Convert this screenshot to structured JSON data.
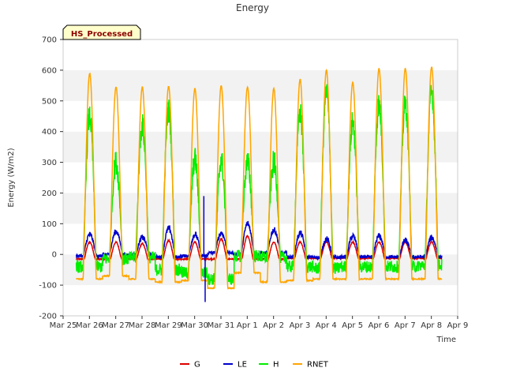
{
  "chart_data": {
    "type": "line",
    "title": "Energy",
    "xlabel": "Time",
    "ylabel": "Energy (W/m2)",
    "ylim": [
      -200,
      700
    ],
    "yticks": [
      -200,
      -100,
      0,
      100,
      200,
      300,
      400,
      500,
      600,
      700
    ],
    "xlim": [
      "Mar 25",
      "Apr 9"
    ],
    "xtick_labels": [
      "Mar 25",
      "Mar 26",
      "Mar 27",
      "Mar 28",
      "Mar 29",
      "Mar 30",
      "Mar 31",
      "Apr 1",
      "Apr 2",
      "Apr 3",
      "Apr 4",
      "Apr 5",
      "Apr 6",
      "Apr 7",
      "Apr 8",
      "Apr 9"
    ],
    "grid": "horizontal bands",
    "legend_position": "bottom",
    "annotation": "HS_Processed",
    "days": [
      "Mar 25",
      "Mar 26",
      "Mar 27",
      "Mar 28",
      "Mar 29",
      "Mar 30",
      "Mar 31",
      "Apr 1",
      "Apr 2",
      "Apr 3",
      "Apr 4",
      "Apr 5",
      "Apr 6",
      "Apr 7",
      "Apr 8"
    ],
    "series": [
      {
        "name": "G",
        "color": "#dd0000",
        "daily_peak": [
          null,
          40,
          40,
          35,
          45,
          40,
          50,
          60,
          40,
          40,
          40,
          40,
          40,
          40,
          40
        ],
        "night_level": [
          null,
          -15,
          -15,
          -15,
          -15,
          -15,
          -15,
          -15,
          -15,
          -12,
          -12,
          -12,
          -12,
          -12,
          -12
        ]
      },
      {
        "name": "LE",
        "color": "#0000cc",
        "daily_peak": [
          null,
          65,
          75,
          55,
          85,
          65,
          70,
          100,
          80,
          70,
          50,
          60,
          60,
          45,
          55
        ],
        "night_level": [
          null,
          -5,
          0,
          0,
          -8,
          -5,
          5,
          0,
          5,
          -8,
          -10,
          -8,
          -8,
          -8,
          -8
        ],
        "extremes": [
          {
            "date": "Mar 30",
            "value": 190
          },
          {
            "date": "Mar 30",
            "value": -155
          }
        ]
      },
      {
        "name": "H",
        "color": "#00ee00",
        "daily_peak": [
          null,
          450,
          300,
          420,
          470,
          310,
          310,
          300,
          300,
          460,
          530,
          430,
          490,
          490,
          530
        ],
        "night_level": [
          null,
          -40,
          -15,
          -10,
          -50,
          -60,
          -80,
          -5,
          -10,
          -40,
          -45,
          -40,
          -40,
          -40,
          -35
        ]
      },
      {
        "name": "RNET",
        "color": "#ffa500",
        "daily_peak": [
          null,
          590,
          545,
          545,
          548,
          540,
          550,
          545,
          540,
          570,
          600,
          560,
          605,
          605,
          610
        ],
        "night_level": [
          null,
          -80,
          -70,
          -80,
          -90,
          -85,
          -110,
          -60,
          -90,
          -85,
          -80,
          -80,
          -80,
          -80,
          -80
        ]
      }
    ]
  }
}
